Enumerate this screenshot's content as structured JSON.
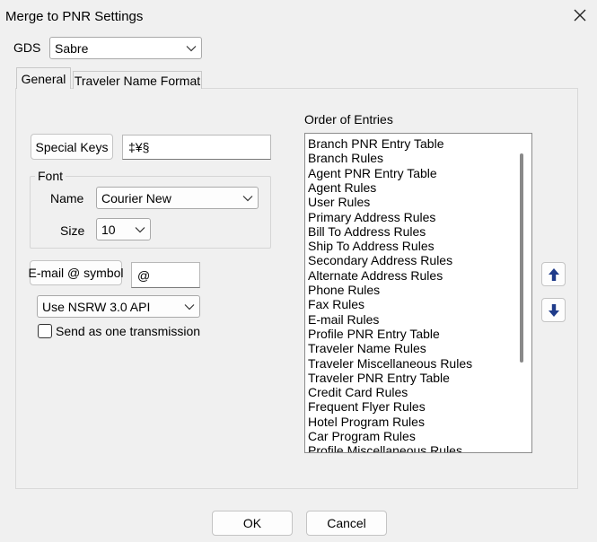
{
  "window": {
    "title": "Merge to PNR Settings"
  },
  "gds": {
    "label": "GDS",
    "value": "Sabre"
  },
  "tabs": [
    {
      "label": "General",
      "active": true
    },
    {
      "label": "Traveler Name Format",
      "active": false
    }
  ],
  "general": {
    "special_keys_button": "Special Keys",
    "special_keys_value": "‡¥§",
    "font_group_label": "Font",
    "font_name_label": "Name",
    "font_name_value": "Courier New",
    "font_size_label": "Size",
    "font_size_value": "10",
    "email_symbol_button": "E-mail @ symbol",
    "email_symbol_value": "@",
    "api_value": "Use NSRW 3.0 API",
    "send_one_label": "Send as one transmission",
    "send_one_checked": false
  },
  "order": {
    "label": "Order of Entries",
    "items": [
      "Branch PNR Entry Table",
      "Branch Rules",
      "Agent PNR Entry Table",
      "Agent Rules",
      "User Rules",
      "Primary Address Rules",
      "Bill To Address Rules",
      "Ship To Address Rules",
      "Secondary Address Rules",
      "Alternate Address Rules",
      "Phone Rules",
      "Fax Rules",
      "E-mail Rules",
      "Profile PNR Entry Table",
      "Traveler Name Rules",
      "Traveler Miscellaneous Rules",
      "Traveler PNR Entry Table",
      "Credit Card Rules",
      "Frequent Flyer Rules",
      "Hotel Program Rules",
      "Car Program Rules",
      "Profile Miscellaneous Rules"
    ]
  },
  "footer": {
    "ok_label": "OK",
    "cancel_label": "Cancel"
  },
  "colors": {
    "arrow": "#1f3b8a",
    "accent": "#0067c0"
  }
}
